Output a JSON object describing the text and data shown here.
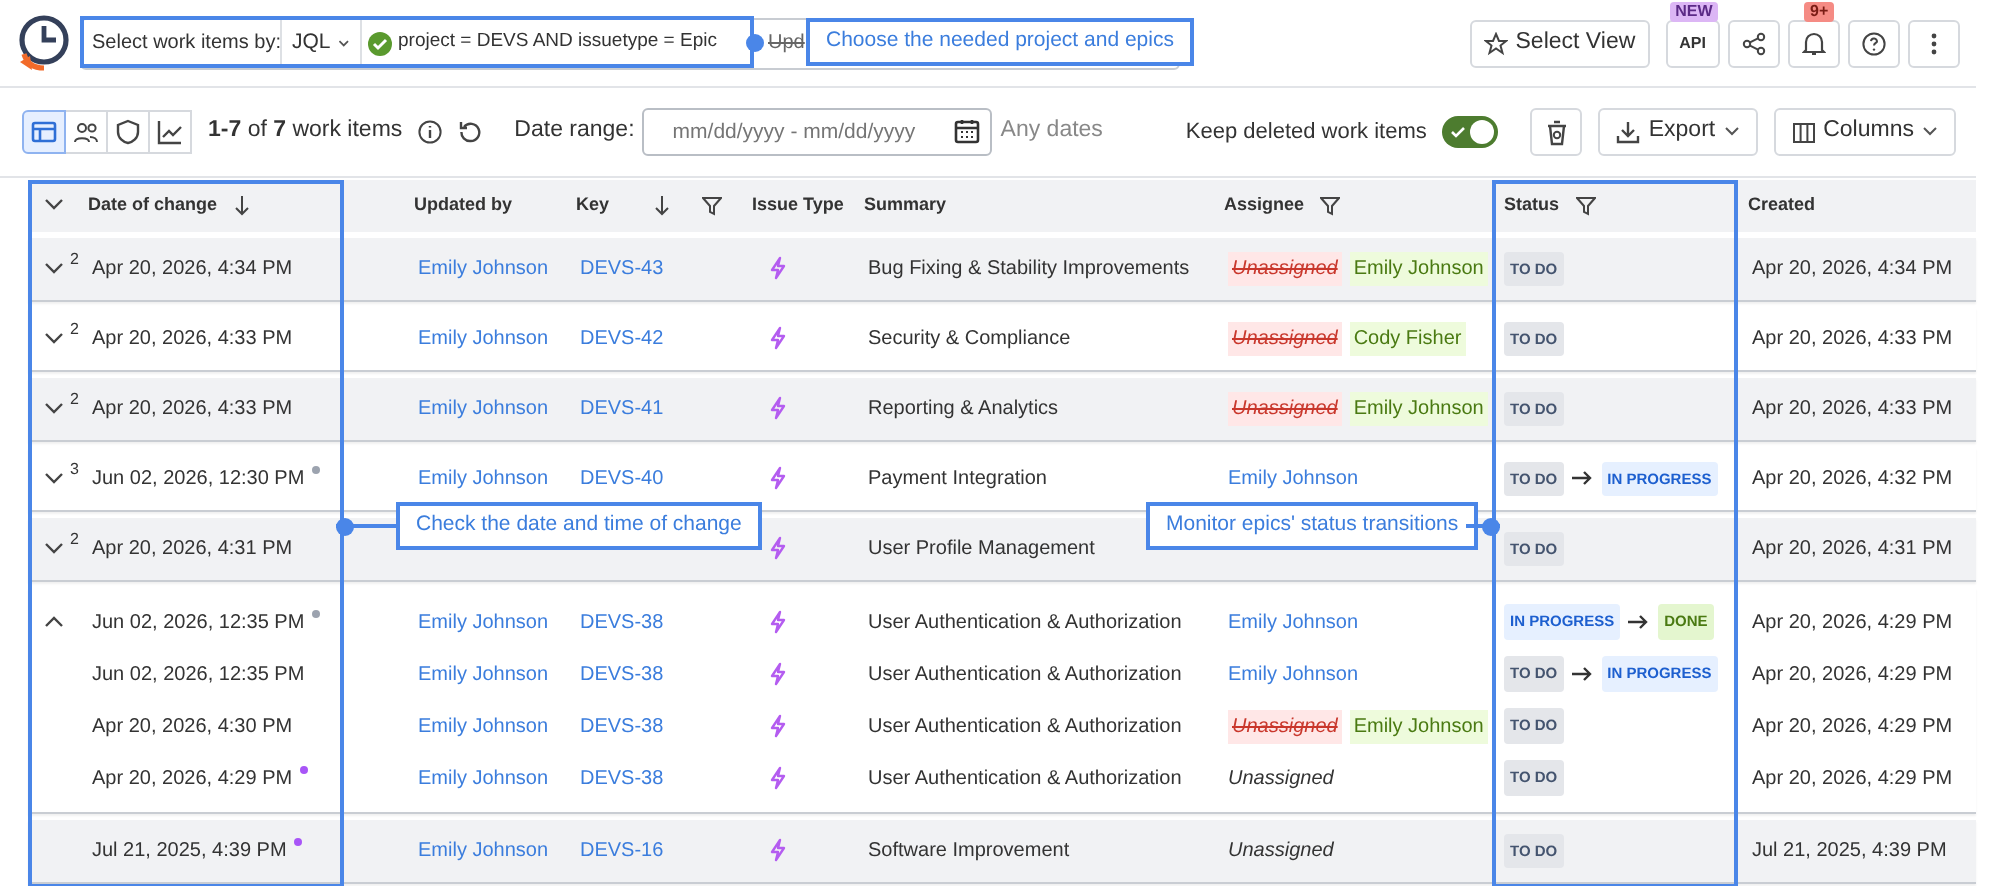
{
  "filter": {
    "label": "Select work items by:",
    "mode": "JQL",
    "query": "project = DEVS AND issuetype = Epic",
    "cut_text": "Upd"
  },
  "top_buttons": {
    "select_view": "Select View",
    "api": "API",
    "api_badge": "NEW",
    "notifications_badge": "9+"
  },
  "toolbar": {
    "views": [
      {
        "selected": true
      },
      {
        "selected": false
      },
      {
        "selected": false
      },
      {
        "selected": false
      }
    ],
    "count": "**1-7** of **7** work items",
    "date_label": "Date range:",
    "date_placeholder": "mm/dd/yyyy - mm/dd/yyyy",
    "date_note": "Any dates",
    "keep_deleted": {
      "label": "Keep deleted work items",
      "on": true
    },
    "export": "Export",
    "columns": "Columns"
  },
  "table": {
    "columns": [
      "Date of change",
      "Updated by",
      "Key",
      "Issue Type",
      "Summary",
      "Assignee",
      "Status",
      "Created"
    ],
    "groups": [
      {
        "expanded": false,
        "count": "2",
        "rows": [
          {
            "date": "Apr 20, 2026, 4:34 PM",
            "updated_by": "Emily Johnson",
            "key": "DEVS-43",
            "summary": "Bug Fixing & Stability Improvements",
            "assignee": {
              "kind": "change",
              "from": "Unassigned",
              "to": "Emily Johnson"
            },
            "status": [
              {
                "label": "TO DO",
                "kind": "todo"
              }
            ],
            "created": "Apr 20, 2026, 4:34 PM"
          }
        ]
      },
      {
        "expanded": false,
        "count": "2",
        "rows": [
          {
            "date": "Apr 20, 2026, 4:33 PM",
            "updated_by": "Emily Johnson",
            "key": "DEVS-42",
            "summary": "Security & Compliance",
            "assignee": {
              "kind": "change",
              "from": "Unassigned",
              "to": "Cody Fisher"
            },
            "status": [
              {
                "label": "TO DO",
                "kind": "todo"
              }
            ],
            "created": "Apr 20, 2026, 4:33 PM"
          }
        ]
      },
      {
        "expanded": false,
        "count": "2",
        "rows": [
          {
            "date": "Apr 20, 2026, 4:33 PM",
            "updated_by": "Emily Johnson",
            "key": "DEVS-41",
            "summary": "Reporting & Analytics",
            "assignee": {
              "kind": "change",
              "from": "Unassigned",
              "to": "Emily Johnson"
            },
            "status": [
              {
                "label": "TO DO",
                "kind": "todo"
              }
            ],
            "created": "Apr 20, 2026, 4:33 PM"
          }
        ]
      },
      {
        "expanded": false,
        "count": "3",
        "rows": [
          {
            "date": "Jun 02, 2026, 12:30 PM",
            "color": "#9ca3af",
            "updated_by": "Emily Johnson",
            "key": "DEVS-40",
            "summary": "Payment Integration",
            "assignee": {
              "kind": "user",
              "name": "Emily Johnson"
            },
            "status": [
              {
                "label": "TO DO",
                "kind": "todo"
              },
              {
                "label": "IN PROGRESS",
                "kind": "progress"
              }
            ],
            "created": "Apr 20, 2026, 4:32 PM"
          }
        ]
      },
      {
        "expanded": false,
        "count": "2",
        "rows": [
          {
            "date": "Apr 20, 2026, 4:31 PM",
            "summary": "User Profile Management",
            "status": [
              {
                "label": "TO DO",
                "kind": "todo"
              }
            ],
            "created": "Apr 20, 2026, 4:31 PM"
          }
        ]
      },
      {
        "expanded": true,
        "rows": [
          {
            "date": "Jun 02, 2026, 12:35 PM",
            "color": "#9ca3af",
            "updated_by": "Emily Johnson",
            "key": "DEVS-38",
            "summary": "User Authentication & Authorization",
            "assignee": {
              "kind": "user",
              "name": "Emily Johnson"
            },
            "status": [
              {
                "label": "IN PROGRESS",
                "kind": "progress"
              },
              {
                "label": "DONE",
                "kind": "done"
              }
            ],
            "created": "Apr 20, 2026, 4:29 PM"
          },
          {
            "date": "Jun 02, 2026, 12:35 PM",
            "updated_by": "Emily Johnson",
            "key": "DEVS-38",
            "summary": "User Authentication & Authorization",
            "assignee": {
              "kind": "user",
              "name": "Emily Johnson"
            },
            "status": [
              {
                "label": "TO DO",
                "kind": "todo"
              },
              {
                "label": "IN PROGRESS",
                "kind": "progress"
              }
            ],
            "created": "Apr 20, 2026, 4:29 PM"
          },
          {
            "date": "Apr 20, 2026, 4:30 PM",
            "updated_by": "Emily Johnson",
            "key": "DEVS-38",
            "summary": "User Authentication & Authorization",
            "assignee": {
              "kind": "change",
              "from": "Unassigned",
              "to": "Emily Johnson"
            },
            "status": [
              {
                "label": "TO DO",
                "kind": "todo"
              }
            ],
            "created": "Apr 20, 2026, 4:29 PM"
          },
          {
            "date": "Apr 20, 2026, 4:29 PM",
            "color": "#a855f7",
            "updated_by": "Emily Johnson",
            "key": "DEVS-38",
            "summary": "User Authentication & Authorization",
            "assignee": {
              "kind": "unassigned",
              "name": "Unassigned"
            },
            "status": [
              {
                "label": "TO DO",
                "kind": "todo"
              }
            ],
            "created": "Apr 20, 2026, 4:29 PM"
          }
        ]
      },
      {
        "rows": [
          {
            "date": "Jul 21, 2025, 4:39 PM",
            "color": "#a855f7",
            "updated_by": "Emily Johnson",
            "key": "DEVS-16",
            "summary": "Software Improvement",
            "assignee": {
              "kind": "unassigned",
              "name": "Unassigned"
            },
            "status": [
              {
                "label": "TO DO",
                "kind": "todo"
              }
            ],
            "created": "Jul 21, 2025, 4:39 PM"
          }
        ]
      }
    ]
  },
  "callouts": [
    "Choose the needed project and epics",
    "Check the date and time of change",
    "Monitor epics' status transitions"
  ]
}
